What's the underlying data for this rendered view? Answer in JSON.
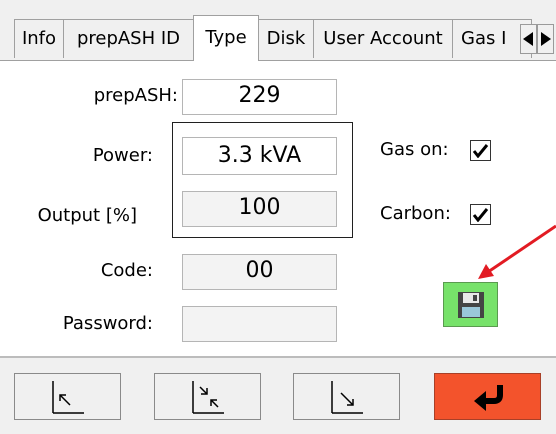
{
  "tabs": [
    {
      "label": "Info",
      "active": false
    },
    {
      "label": "prepASH ID",
      "active": false
    },
    {
      "label": "Type",
      "active": true
    },
    {
      "label": "Disk",
      "active": false
    },
    {
      "label": "User Account",
      "active": false
    },
    {
      "label": "Gas I",
      "active": false
    }
  ],
  "form": {
    "prepash_label": "prepASH:",
    "prepash_value": "229",
    "power_label": "Power:",
    "power_value": "3.3 kVA",
    "output_label": "Output [%]",
    "output_value": "100",
    "code_label": "Code:",
    "code_value": "00",
    "password_label": "Password:",
    "password_value": "",
    "gas_on_label": "Gas on:",
    "gas_on_checked": true,
    "carbon_label": "Carbon:",
    "carbon_checked": true
  },
  "icons": {
    "tab_scroll_left": "triangle-left-icon",
    "tab_scroll_right": "triangle-right-icon",
    "save": "floppy-disk-icon",
    "bottom_1": "arrow-up-left-icon",
    "bottom_2": "arrows-collapse-diagonal-icon",
    "bottom_3": "arrow-down-right-icon",
    "bottom_4": "return-arrow-icon"
  },
  "colors": {
    "save_button": "#77e26a",
    "return_button": "#f3532c",
    "annotation_arrow": "#e21b23"
  }
}
